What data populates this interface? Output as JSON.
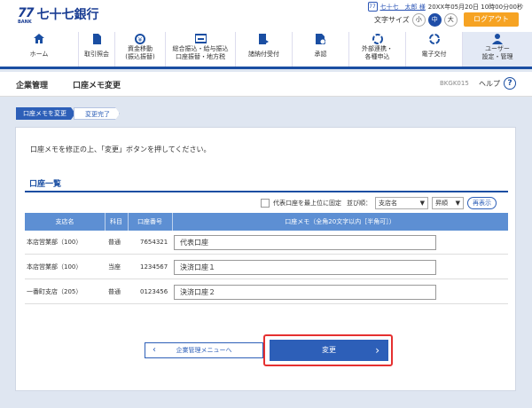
{
  "header": {
    "logo_mark": "77",
    "logo_bank": "BANK",
    "logo_name": "七十七銀行",
    "user_icon": "77",
    "user_name": "七十七　太郎 様",
    "datetime": "20XX年05月20日 10時00分00秒",
    "text_size_label": "文字サイズ",
    "text_sizes": [
      "小",
      "中",
      "大"
    ],
    "text_size_selected": "中",
    "logout_label": "ログアウト"
  },
  "nav": {
    "items": [
      {
        "icon": "home-icon",
        "label": "ホーム"
      },
      {
        "icon": "inquiry-icon",
        "label": "取引照会"
      },
      {
        "icon": "fund-transfer-icon",
        "label": "資金移動\n(振込振替)"
      },
      {
        "icon": "bulk-transfer-icon",
        "label": "総合振込・給与振込\n口座振替・地方税"
      },
      {
        "icon": "request-icon",
        "label": "諸納付受付"
      },
      {
        "icon": "approval-icon",
        "label": "承認"
      },
      {
        "icon": "external-link-icon",
        "label": "外部連携・\n各種申込"
      },
      {
        "icon": "e-delivery-icon",
        "label": "電子交付"
      },
      {
        "icon": "user-settings-icon",
        "label": "ユーザー\n設定・管理"
      }
    ],
    "active_index": 8
  },
  "titlebar": {
    "section": "企業管理",
    "page_title": "口座メモ変更",
    "screen_code": "BKGK015",
    "help_label": "ヘルプ",
    "help_icon": "?"
  },
  "steps": [
    "口座メモを変更",
    "変更完了"
  ],
  "instruction": "口座メモを修正の上、「変更」ボタンを押してください。",
  "section_title": "口座一覧",
  "controls": {
    "pin_label": "代表口座を最上位に固定",
    "sort_label": "並び順：",
    "sort_key": "支店名",
    "sort_order": "昇順",
    "redisplay_label": "再表示"
  },
  "table": {
    "headers": [
      "支店名",
      "科目",
      "口座番号",
      "口座メモ（全角20文字以内［半角可］）"
    ],
    "rows": [
      {
        "branch": "本店営業部（100）",
        "type": "普通",
        "account": "7654321",
        "memo": "代表口座"
      },
      {
        "branch": "本店営業部（100）",
        "type": "当座",
        "account": "1234567",
        "memo": "決済口座１"
      },
      {
        "branch": "一番町支店（205）",
        "type": "普通",
        "account": "0123456",
        "memo": "決済口座２"
      }
    ]
  },
  "buttons": {
    "back_label": "企業管理メニューへ",
    "submit_label": "変更"
  },
  "colors": {
    "brand": "#1a4ea2",
    "accent": "#f6a323",
    "highlight": "#e53030"
  }
}
